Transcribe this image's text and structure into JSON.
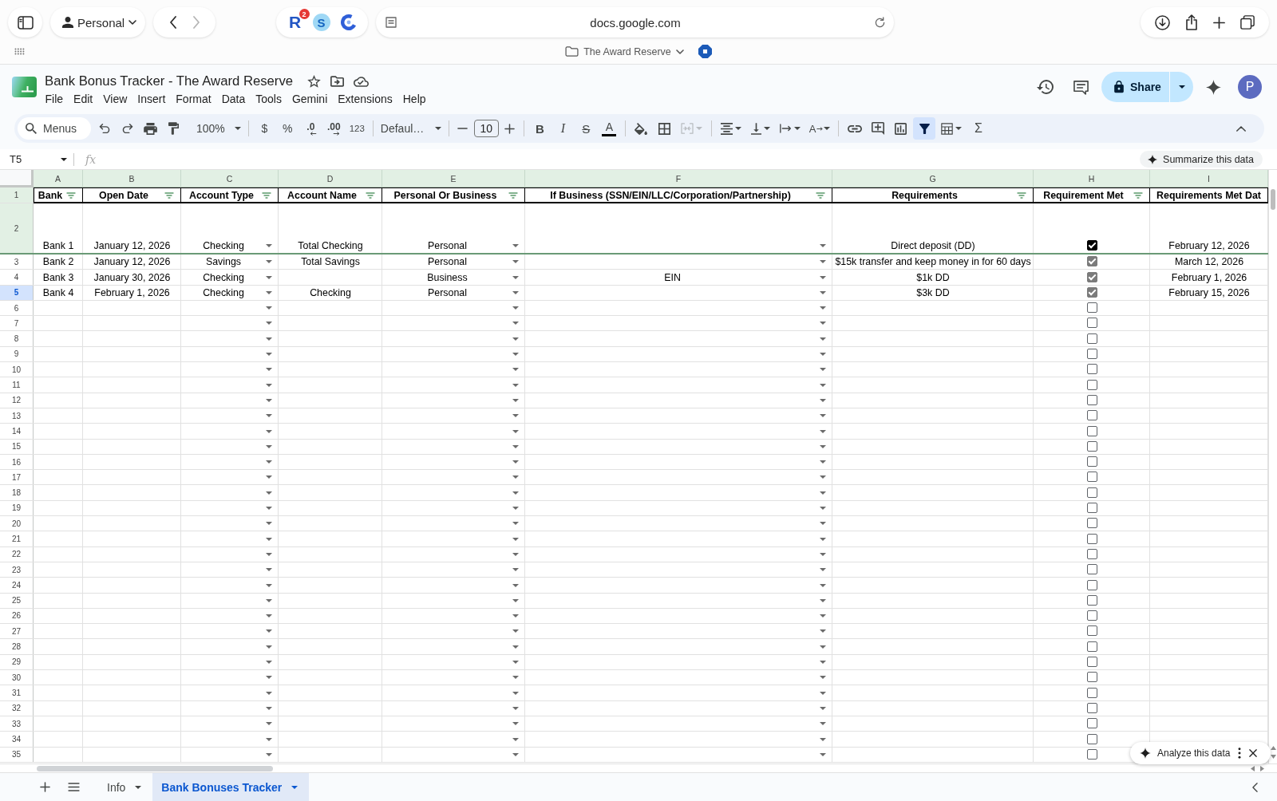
{
  "browser": {
    "profile": "Personal",
    "back": {
      "disabled": false
    },
    "forward": {
      "disabled": true
    },
    "extensions": [
      {
        "kind": "letter",
        "label": "R",
        "badge": "2"
      },
      {
        "kind": "circle",
        "label": "S"
      },
      {
        "kind": "logo"
      }
    ],
    "address": "docs.google.com",
    "bookmark": "The Award Reserve"
  },
  "doc": {
    "title": "Bank Bonus Tracker - The Award Reserve",
    "menu": [
      "File",
      "Edit",
      "View",
      "Insert",
      "Format",
      "Data",
      "Tools",
      "Gemini",
      "Extensions",
      "Help"
    ],
    "share": "Share",
    "avatar": "P"
  },
  "toolbar": {
    "search": {
      "placeholder": "Menus"
    },
    "zoom": "100%",
    "currency": "$",
    "percent": "%",
    "decrease_decimals": ".0",
    "increase_decimals": ".00",
    "number_format": "123",
    "font": "Defaul…",
    "font_size": "10",
    "bold": "B",
    "italic": "I",
    "strikethrough": "S",
    "text_color": "A",
    "text_rotation": "A",
    "functions": "Σ",
    "merge": {
      "disabled": true
    },
    "filter": {
      "selected": true
    }
  },
  "formula_bar": {
    "cell": "T5",
    "fx": "fx",
    "summarize": "Summarize this data"
  },
  "sheet": {
    "columns": [
      {
        "letter": "A",
        "header": "Bank",
        "kind": "text",
        "filter": true
      },
      {
        "letter": "B",
        "header": "Open Date",
        "kind": "text",
        "filter": true
      },
      {
        "letter": "C",
        "header": "Account Type",
        "kind": "dropdown",
        "filter": true
      },
      {
        "letter": "D",
        "header": "Account Name",
        "kind": "text",
        "filter": true
      },
      {
        "letter": "E",
        "header": "Personal Or Business",
        "kind": "dropdown",
        "filter": true
      },
      {
        "letter": "F",
        "header": "If Business (SSN/EIN/LLC/Corporation/Partnership)",
        "kind": "dropdown",
        "filter": true
      },
      {
        "letter": "G",
        "header": "Requirements",
        "kind": "text",
        "filter": true
      },
      {
        "letter": "H",
        "header": "Requirement Met",
        "kind": "checkbox",
        "filter": true
      },
      {
        "letter": "I",
        "header": "Requirements Met Dat",
        "kind": "text",
        "filter": false
      }
    ],
    "header_row": {
      "number": "1",
      "frozen": true,
      "selected": false
    },
    "rows": [
      {
        "number": "2",
        "frozen": true,
        "selected": false,
        "bank": "Bank 1",
        "open_date": "January 12, 2026",
        "account_type": "Checking",
        "account_name": "Total Checking",
        "personal_or_business": "Personal",
        "requirements": "Direct deposit (DD)",
        "requirement_met": {
          "checked": true,
          "color": "#000000"
        },
        "column_9": "February 12, 2026"
      },
      {
        "number": "3",
        "frozen": false,
        "selected": false,
        "bank": "Bank 2",
        "open_date": "January 12, 2026",
        "account_type": "Savings",
        "account_name": "Total Savings",
        "personal_or_business": "Personal",
        "requirements": "$15k transfer and keep money in for 60 days",
        "requirement_met": {
          "checked": true,
          "color": "#7b7b7b"
        },
        "column_9": "March 12, 2026"
      },
      {
        "number": "4",
        "frozen": false,
        "selected": false,
        "bank": "Bank 3",
        "open_date": "January 30, 2026",
        "account_type": "Checking",
        "personal_or_business": "Business",
        "if_business": "EIN",
        "requirements": "$1k DD",
        "requirement_met": {
          "checked": true,
          "color": "#7b7b7b"
        },
        "column_9": "February 1, 2026"
      },
      {
        "number": "5",
        "frozen": false,
        "selected": true,
        "bank": "Bank 4",
        "open_date": "February 1, 2026",
        "account_type": "Checking",
        "account_name": "Checking",
        "personal_or_business": "Personal",
        "requirements": "$3k DD",
        "requirement_met": {
          "checked": true,
          "color": "#7b7b7b"
        },
        "column_9": "February 15, 2026"
      },
      {
        "number": "6",
        "frozen": false,
        "selected": false,
        "requirement_met": {
          "checked": false
        }
      },
      {
        "number": "7",
        "frozen": false,
        "selected": false,
        "requirement_met": {
          "checked": false
        }
      },
      {
        "number": "8",
        "frozen": false,
        "selected": false,
        "requirement_met": {
          "checked": false
        }
      },
      {
        "number": "9",
        "frozen": false,
        "selected": false,
        "requirement_met": {
          "checked": false
        }
      },
      {
        "number": "10",
        "frozen": false,
        "selected": false,
        "requirement_met": {
          "checked": false
        }
      },
      {
        "number": "11",
        "frozen": false,
        "selected": false,
        "requirement_met": {
          "checked": false
        }
      },
      {
        "number": "12",
        "frozen": false,
        "selected": false,
        "requirement_met": {
          "checked": false
        }
      },
      {
        "number": "13",
        "frozen": false,
        "selected": false,
        "requirement_met": {
          "checked": false
        }
      },
      {
        "number": "14",
        "frozen": false,
        "selected": false,
        "requirement_met": {
          "checked": false
        }
      },
      {
        "number": "15",
        "frozen": false,
        "selected": false,
        "requirement_met": {
          "checked": false
        }
      },
      {
        "number": "16",
        "frozen": false,
        "selected": false,
        "requirement_met": {
          "checked": false
        }
      },
      {
        "number": "17",
        "frozen": false,
        "selected": false,
        "requirement_met": {
          "checked": false
        }
      },
      {
        "number": "18",
        "frozen": false,
        "selected": false,
        "requirement_met": {
          "checked": false
        }
      },
      {
        "number": "19",
        "frozen": false,
        "selected": false,
        "requirement_met": {
          "checked": false
        }
      },
      {
        "number": "20",
        "frozen": false,
        "selected": false,
        "requirement_met": {
          "checked": false
        }
      },
      {
        "number": "21",
        "frozen": false,
        "selected": false,
        "requirement_met": {
          "checked": false
        }
      },
      {
        "number": "22",
        "frozen": false,
        "selected": false,
        "requirement_met": {
          "checked": false
        }
      },
      {
        "number": "23",
        "frozen": false,
        "selected": false,
        "requirement_met": {
          "checked": false
        }
      },
      {
        "number": "24",
        "frozen": false,
        "selected": false,
        "requirement_met": {
          "checked": false
        }
      },
      {
        "number": "25",
        "frozen": false,
        "selected": false,
        "requirement_met": {
          "checked": false
        }
      },
      {
        "number": "26",
        "frozen": false,
        "selected": false,
        "requirement_met": {
          "checked": false
        }
      },
      {
        "number": "27",
        "frozen": false,
        "selected": false,
        "requirement_met": {
          "checked": false
        }
      },
      {
        "number": "28",
        "frozen": false,
        "selected": false,
        "requirement_met": {
          "checked": false
        }
      },
      {
        "number": "29",
        "frozen": false,
        "selected": false,
        "requirement_met": {
          "checked": false
        }
      },
      {
        "number": "30",
        "frozen": false,
        "selected": false,
        "requirement_met": {
          "checked": false
        }
      },
      {
        "number": "31",
        "frozen": false,
        "selected": false,
        "requirement_met": {
          "checked": false
        }
      },
      {
        "number": "32",
        "frozen": false,
        "selected": false,
        "requirement_met": {
          "checked": false
        }
      },
      {
        "number": "33",
        "frozen": false,
        "selected": false,
        "requirement_met": {
          "checked": false
        }
      },
      {
        "number": "34",
        "frozen": false,
        "selected": false,
        "requirement_met": {
          "checked": false
        }
      },
      {
        "number": "35",
        "frozen": false,
        "selected": false,
        "requirement_met": {
          "checked": false
        }
      }
    ]
  },
  "assistant_chip": "Analyze this data",
  "tabs": [
    {
      "label": "Info",
      "selected": false
    },
    {
      "label": "Bank Bonuses Tracker",
      "selected": true
    }
  ]
}
